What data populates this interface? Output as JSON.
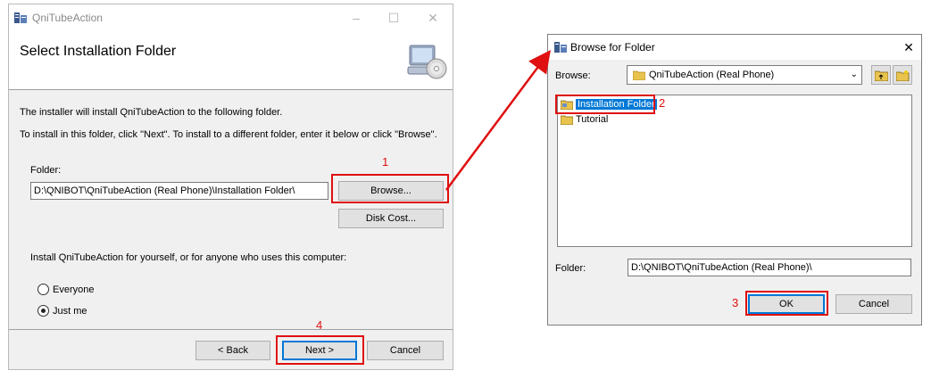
{
  "installer": {
    "title": "QniTubeAction",
    "header": "Select Installation Folder",
    "line1": "The installer will install QniTubeAction to the following folder.",
    "line2": "To install in this folder, click \"Next\". To install to a different folder, enter it below or click \"Browse\".",
    "folder_label": "Folder:",
    "folder_value": "D:\\QNIBOT\\QniTubeAction (Real Phone)\\Installation Folder\\",
    "browse_label": "Browse...",
    "diskcost_label": "Disk Cost...",
    "install_for": "Install QniTubeAction for yourself, or for anyone who uses this computer:",
    "radio_everyone": "Everyone",
    "radio_justme": "Just me",
    "selected_option": "Just me",
    "back_label": "< Back",
    "next_label": "Next >",
    "cancel_label": "Cancel"
  },
  "browse_dialog": {
    "title": "Browse for Folder",
    "browse_label": "Browse:",
    "browse_value": "QniTubeAction (Real Phone)",
    "tree_items": [
      "Installation Folder",
      "Tutorial"
    ],
    "selected_item": "Installation Folder",
    "folder_label": "Folder:",
    "folder_value": "D:\\QNIBOT\\QniTubeAction (Real Phone)\\",
    "ok_label": "OK",
    "cancel_label": "Cancel",
    "close_glyph": "✕"
  },
  "annotations": {
    "step1": "1",
    "step2": "2",
    "step3": "3",
    "step4": "4",
    "color": "#e01010"
  }
}
